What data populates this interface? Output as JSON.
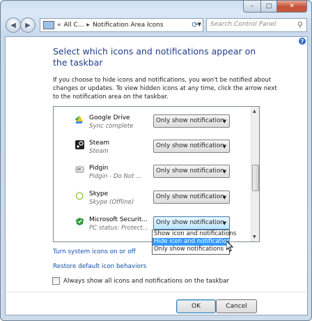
{
  "window": {
    "caption_buttons": {
      "minimize": "–",
      "maximize": "□",
      "close": "✕"
    }
  },
  "nav": {
    "breadcrumb": [
      "All C...",
      "Notification Area Icons"
    ],
    "search_placeholder": "Search Control Panel"
  },
  "page": {
    "title": "Select which icons and notifications appear on the taskbar",
    "description": "If you choose to hide icons and notifications, you won't be notified about changes or updates. To view hidden icons at any time, click the arrow next to the notification area on the taskbar."
  },
  "icons_list": {
    "rows": [
      {
        "name": "Google Drive",
        "status": "Sync complete",
        "behavior": "Only show notification",
        "icon": "google-drive-icon"
      },
      {
        "name": "Steam",
        "status": "Steam",
        "behavior": "Only show notification",
        "icon": "steam-icon"
      },
      {
        "name": "Pidgin",
        "status": "Pidgin - Do Not ...",
        "behavior": "Only show notification",
        "icon": "pidgin-icon"
      },
      {
        "name": "Skype",
        "status": "Skype (Offline)",
        "behavior": "Only show notification",
        "icon": "skype-icon"
      },
      {
        "name": "Microsoft Securit...",
        "status": "PC status: Protect...",
        "behavior": "Only show notification",
        "icon": "microsoft-security-icon"
      }
    ]
  },
  "dropdown": {
    "options": [
      "Show icon and notifications",
      "Hide icon and notifications",
      "Only show notifications"
    ],
    "highlighted": "Hide icon and notifications"
  },
  "links": {
    "turn_system_icons": "Turn system icons on or off",
    "restore_defaults": "Restore default icon behaviors"
  },
  "checkbox": {
    "label": "Always show all icons and notifications on the taskbar",
    "checked": false
  },
  "buttons": {
    "ok": "OK",
    "cancel": "Cancel"
  },
  "colors": {
    "title": "#1f3e89",
    "link": "#0f4fa8",
    "highlight": "#3399ff"
  }
}
